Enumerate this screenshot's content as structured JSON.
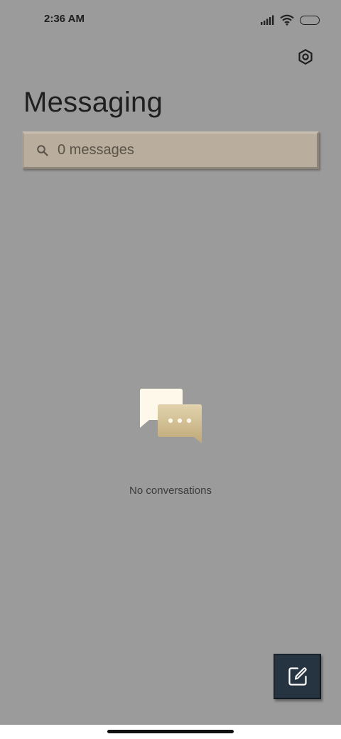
{
  "status_bar": {
    "time": "2:36 AM",
    "icons": [
      "signal-icon",
      "wifi-icon",
      "battery-icon"
    ]
  },
  "header": {
    "title": "Messaging",
    "settings_icon": "gear-icon"
  },
  "search": {
    "placeholder": "0 messages",
    "icon": "search-icon"
  },
  "empty_state": {
    "illustration": "chat-bubbles-icon",
    "message": "No conversations"
  },
  "fab": {
    "icon": "compose-icon"
  },
  "colors": {
    "background": "#9b9b9b",
    "search_bg": "#b9ae9e",
    "fab_bg": "#263340",
    "bubble_light": "#fdf8ea",
    "bubble_gold": "#c9b488"
  }
}
